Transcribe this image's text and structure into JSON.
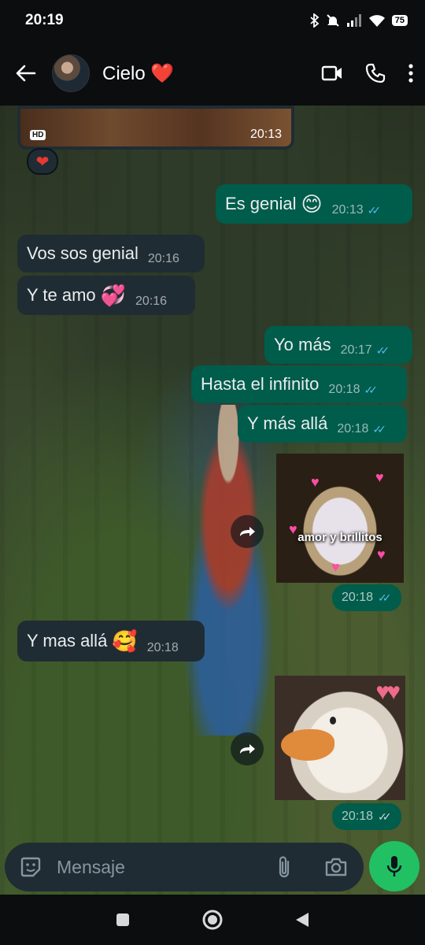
{
  "status_bar": {
    "time": "20:19",
    "battery": "75",
    "icons": [
      "bluetooth-icon",
      "mute-icon",
      "signal-icon",
      "wifi-icon",
      "battery-icon"
    ]
  },
  "header": {
    "contact_name": "Cielo",
    "contact_emoji": "❤️",
    "icons": [
      "back-arrow-icon",
      "video-call-icon",
      "phone-icon",
      "more-options-icon"
    ]
  },
  "messages": {
    "image_top": {
      "badge": "HD",
      "time": "20:13",
      "reaction": "❤"
    },
    "m1": {
      "text": "Es genial",
      "emoji": "😊",
      "time": "20:13",
      "direction": "out"
    },
    "m2": {
      "text": "Vos sos genial",
      "time": "20:16",
      "direction": "in"
    },
    "m3": {
      "text": "Y te amo",
      "emoji": "💞",
      "time": "20:16",
      "direction": "in"
    },
    "m4": {
      "text": "Yo más",
      "time": "20:17",
      "direction": "out"
    },
    "m5": {
      "text": "Hasta el infinito",
      "time": "20:18",
      "direction": "out"
    },
    "m6": {
      "text": "Y más allá",
      "time": "20:18",
      "direction": "out"
    },
    "sticker1": {
      "caption": "amor y brillitos",
      "time": "20:18",
      "direction": "out"
    },
    "m7": {
      "text": "Y mas allá",
      "emoji": "🥰",
      "time": "20:18",
      "direction": "in"
    },
    "sticker2": {
      "time": "20:18",
      "direction": "out"
    }
  },
  "composer": {
    "placeholder": "Mensaje",
    "icons": [
      "sticker-icon",
      "attach-icon",
      "camera-icon",
      "mic-icon"
    ]
  },
  "colors": {
    "incoming_bubble": "#202c33",
    "outgoing_bubble": "#005c4b",
    "read_ticks": "#53bdeb",
    "mic_button": "#21c063"
  }
}
